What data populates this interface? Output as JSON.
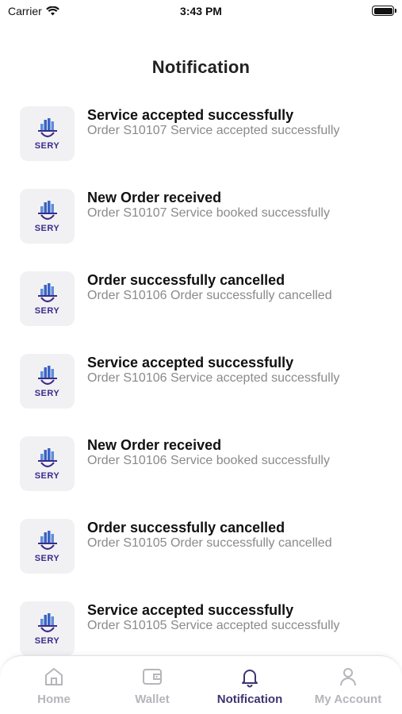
{
  "status_bar": {
    "carrier": "Carrier",
    "time": "3:43 PM"
  },
  "header": {
    "title": "Notification"
  },
  "notifications": [
    {
      "title": "Service accepted successfully",
      "message": "Order S10107 Service accepted successfully",
      "logo": "SERY"
    },
    {
      "title": "New Order received",
      "message": "Order S10107 Service booked successfully",
      "logo": "SERY"
    },
    {
      "title": "Order successfully cancelled",
      "message": "Order S10106 Order successfully cancelled",
      "logo": "SERY"
    },
    {
      "title": "Service accepted successfully",
      "message": "Order S10106 Service accepted successfully",
      "logo": "SERY"
    },
    {
      "title": "New Order received",
      "message": "Order S10106 Service booked successfully",
      "logo": "SERY"
    },
    {
      "title": "Order successfully cancelled",
      "message": "Order S10105 Order successfully cancelled",
      "logo": "SERY"
    },
    {
      "title": "Service accepted successfully",
      "message": "Order S10105 Service accepted successfully",
      "logo": "SERY"
    }
  ],
  "tab_bar": {
    "tabs": [
      {
        "label": "Home",
        "icon": "home-icon",
        "active": false
      },
      {
        "label": "Wallet",
        "icon": "wallet-icon",
        "active": false
      },
      {
        "label": "Notification",
        "icon": "bell-icon",
        "active": true
      },
      {
        "label": "My Account",
        "icon": "user-icon",
        "active": false
      }
    ]
  },
  "colors": {
    "brand": "#3b2a8c",
    "active_tab": "#3e3470",
    "inactive_tab": "#b5b5bb",
    "subtitle": "#8a8a8a"
  }
}
